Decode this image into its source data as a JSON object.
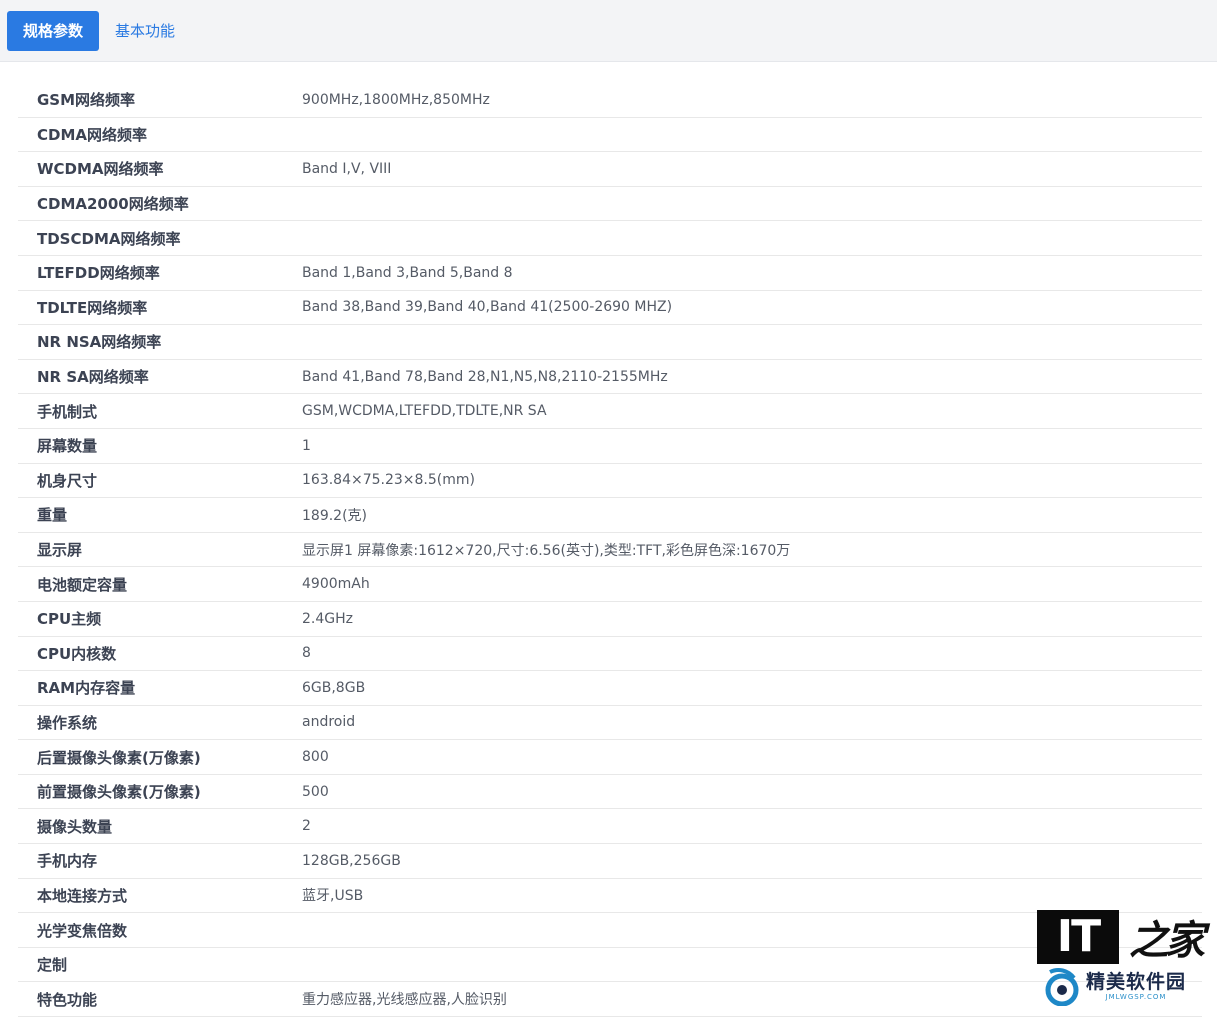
{
  "tabs": [
    {
      "label": "规格参数",
      "active": true
    },
    {
      "label": "基本功能",
      "active": false
    }
  ],
  "specs": [
    {
      "label": "GSM网络频率",
      "value": "900MHz,1800MHz,850MHz"
    },
    {
      "label": "CDMA网络频率",
      "value": ""
    },
    {
      "label": "WCDMA网络频率",
      "value": "Band Ⅰ,V, VIII"
    },
    {
      "label": "CDMA2000网络频率",
      "value": ""
    },
    {
      "label": "TDSCDMA网络频率",
      "value": ""
    },
    {
      "label": "LTEFDD网络频率",
      "value": "Band 1,Band 3,Band 5,Band 8"
    },
    {
      "label": "TDLTE网络频率",
      "value": "Band 38,Band 39,Band 40,Band 41(2500-2690 MHZ)"
    },
    {
      "label": "NR NSA网络频率",
      "value": ""
    },
    {
      "label": "NR SA网络频率",
      "value": "Band 41,Band 78,Band 28,N1,N5,N8,2110-2155MHz"
    },
    {
      "label": "手机制式",
      "value": "GSM,WCDMA,LTEFDD,TDLTE,NR SA"
    },
    {
      "label": "屏幕数量",
      "value": "1"
    },
    {
      "label": "机身尺寸",
      "value": "163.84×75.23×8.5(mm)"
    },
    {
      "label": "重量",
      "value": "189.2(克)"
    },
    {
      "label": "显示屏",
      "value": "显示屏1 屏幕像素:1612×720,尺寸:6.56(英寸),类型:TFT,彩色屏色深:1670万"
    },
    {
      "label": "电池额定容量",
      "value": "4900mAh"
    },
    {
      "label": "CPU主频",
      "value": "2.4GHz"
    },
    {
      "label": "CPU内核数",
      "value": "8"
    },
    {
      "label": "RAM内存容量",
      "value": "6GB,8GB"
    },
    {
      "label": "操作系统",
      "value": "android"
    },
    {
      "label": "后置摄像头像素(万像素)",
      "value": "800"
    },
    {
      "label": "前置摄像头像素(万像素)",
      "value": "500"
    },
    {
      "label": "摄像头数量",
      "value": "2"
    },
    {
      "label": "手机内存",
      "value": "128GB,256GB"
    },
    {
      "label": "本地连接方式",
      "value": "蓝牙,USB"
    },
    {
      "label": "光学变焦倍数",
      "value": ""
    },
    {
      "label": "定制",
      "value": ""
    },
    {
      "label": "特色功能",
      "value": "重力感应器,光线感应器,人脸识别"
    }
  ],
  "watermarks": {
    "ithome": {
      "it": "IT",
      "home": "之家"
    },
    "jmwgsp": {
      "cn": "精美软件园",
      "en": "JMLWGSP.COM"
    }
  },
  "colors": {
    "accent": "#2a7ae2",
    "tabbar_bg": "#f3f4f6",
    "label_text": "#3c4353",
    "value_text": "#555b66",
    "row_border": "#e8e8e8"
  },
  "icons": {
    "jm_logo": "swirl-logo-icon"
  }
}
